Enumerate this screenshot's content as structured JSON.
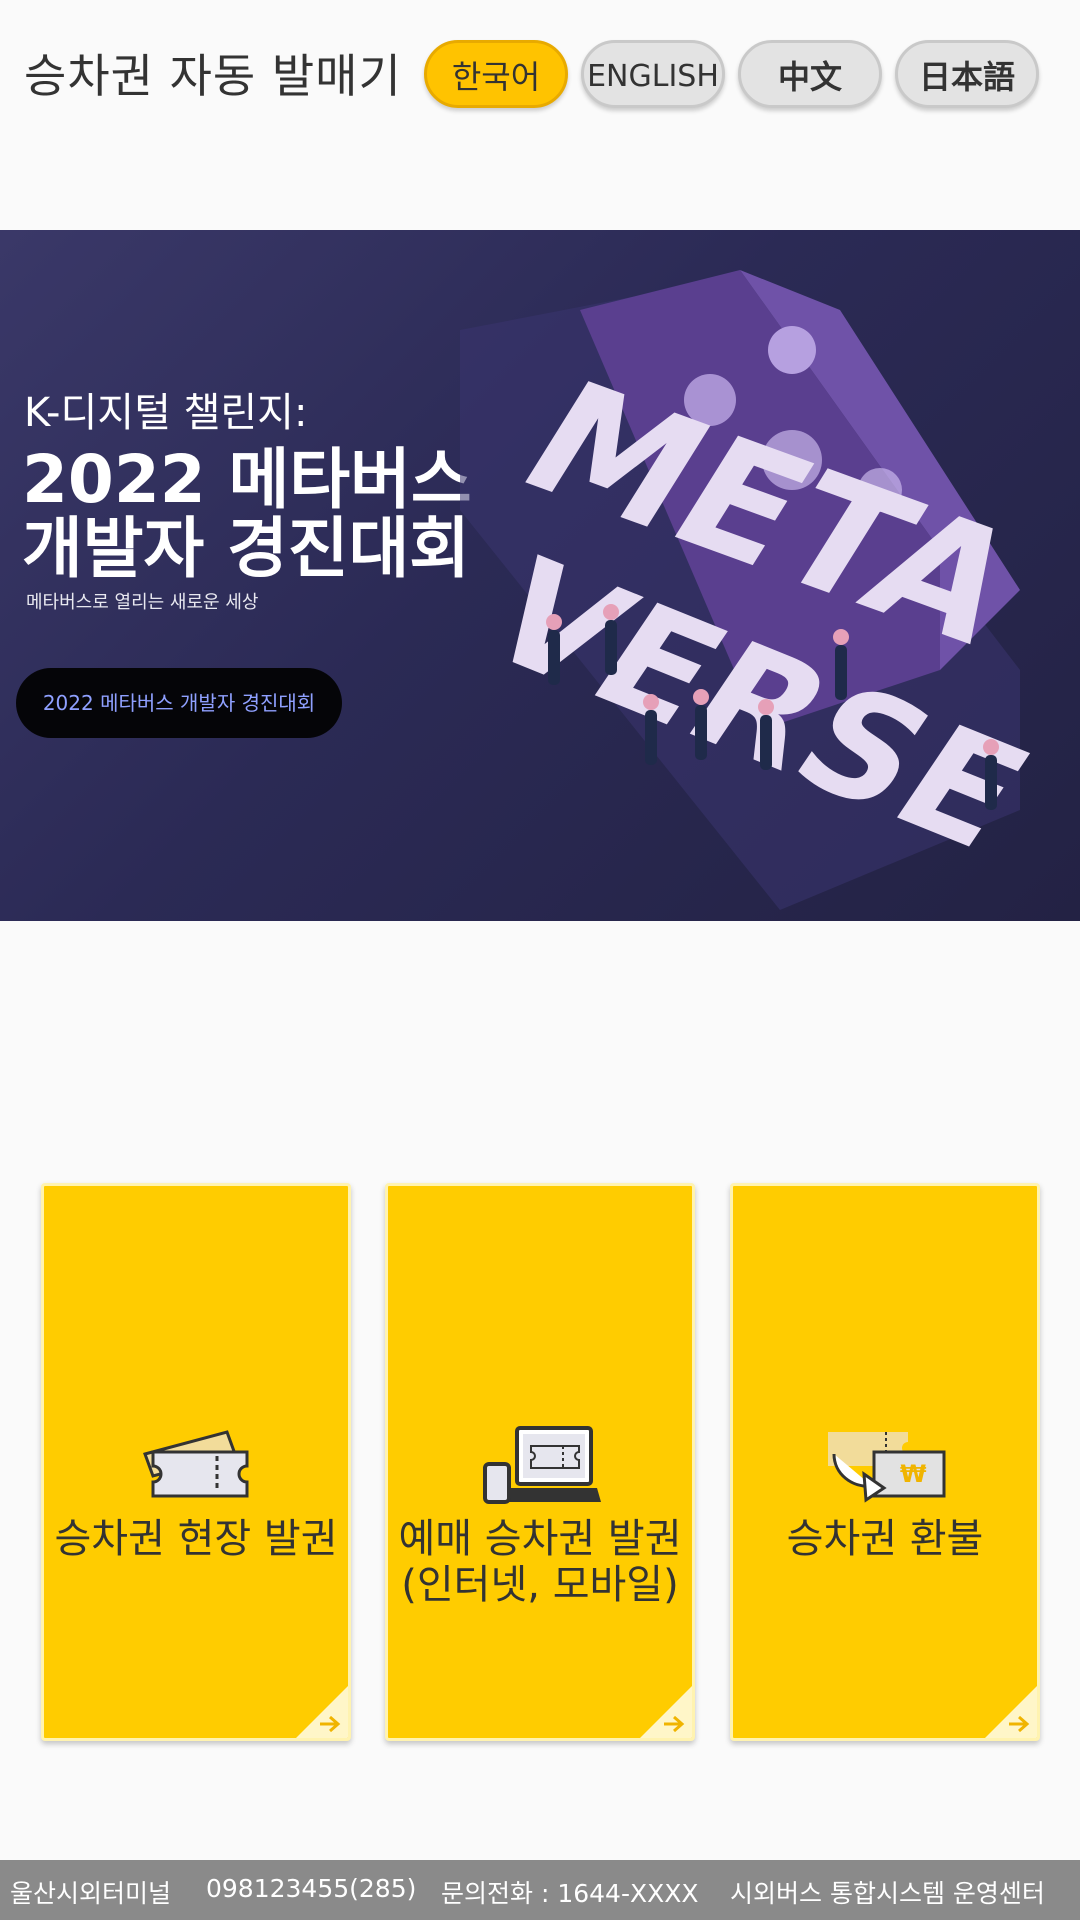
{
  "header": {
    "title": "승차권 자동 발매기",
    "languages": [
      {
        "label": "한국어",
        "active": true
      },
      {
        "label": "ENGLISH",
        "active": false
      },
      {
        "label": "中文",
        "active": false
      },
      {
        "label": "日本語",
        "active": false
      }
    ]
  },
  "banner": {
    "kicker": "K-디지털 챌린지:",
    "title_line1": "2022 메타버스",
    "title_line2": "개발자 경진대회",
    "subtitle": "메타버스로 열리는 새로운 세상",
    "cta_label": "2022 메타버스 개발자 경진대회",
    "art_word1": "META",
    "art_word2": "VERSE"
  },
  "menu": [
    {
      "label_line1": "승차권 현장 발권",
      "label_line2": "",
      "icon": "ticket-icon"
    },
    {
      "label_line1": "예매 승차권 발권",
      "label_line2": "(인터넷, 모바일)",
      "icon": "laptop-phone-ticket-icon"
    },
    {
      "label_line1": "승차권 환불",
      "label_line2": "",
      "icon": "refund-icon",
      "currency_symbol": "₩"
    }
  ],
  "footer": {
    "terminal": "울산시외터미널",
    "device_id": "098123455(285)",
    "phone": "문의전화 : 1644-XXXX",
    "operator": "시외버스 통합시스템 운영센터"
  },
  "colors": {
    "accent": "#ffcc00",
    "active_lang": "#ffc300",
    "banner_bg": "#2b2a55",
    "cta_text": "#8fa0ff",
    "footer_bg": "#8a8a8a"
  }
}
